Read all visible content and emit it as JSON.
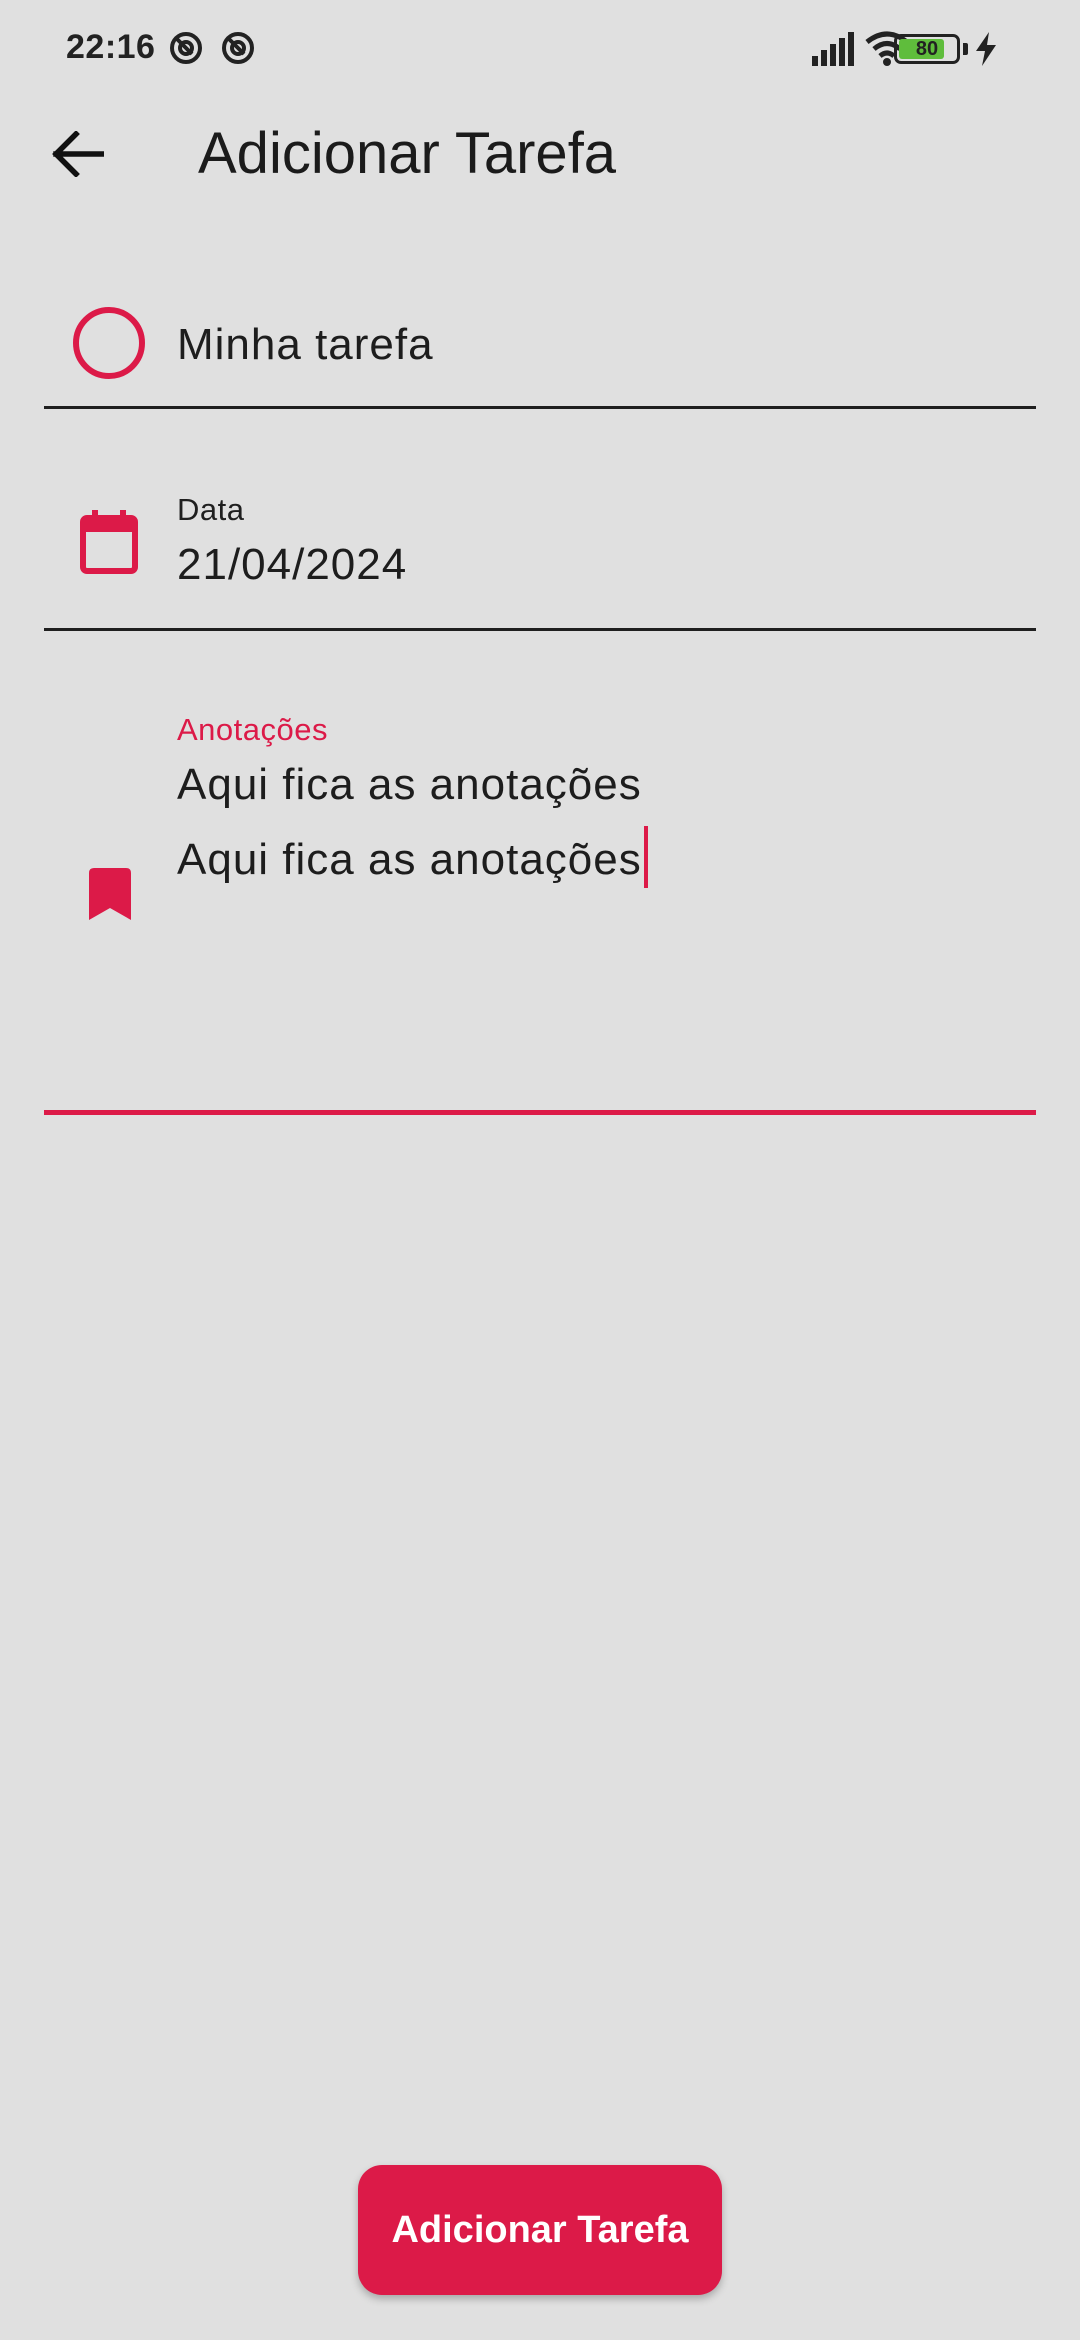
{
  "status_bar": {
    "time": "22:16",
    "battery_level": "80",
    "battery_fraction": 0.8,
    "icons": [
      "notification-app-icon",
      "notification-app-icon",
      "signal-icon",
      "wifi-icon",
      "battery-icon",
      "charging-bolt-icon"
    ]
  },
  "app_bar": {
    "back_icon": "arrow-left-icon",
    "title": "Adicionar Tarefa"
  },
  "form": {
    "task_name": {
      "icon": "circle-outline-icon",
      "value": "Minha tarefa"
    },
    "date": {
      "icon": "calendar-icon",
      "label": "Data",
      "value": "21/04/2024"
    },
    "notes": {
      "icon": "bookmark-icon",
      "label": "Anotações",
      "line1": "Aqui fica as anotações",
      "line2": "Aqui fica as anotações"
    }
  },
  "submit_button": {
    "label": "Adicionar Tarefa"
  },
  "colors": {
    "accent": "#dc1a48",
    "background": "#e0e0e0",
    "text": "#1d1d1d"
  }
}
